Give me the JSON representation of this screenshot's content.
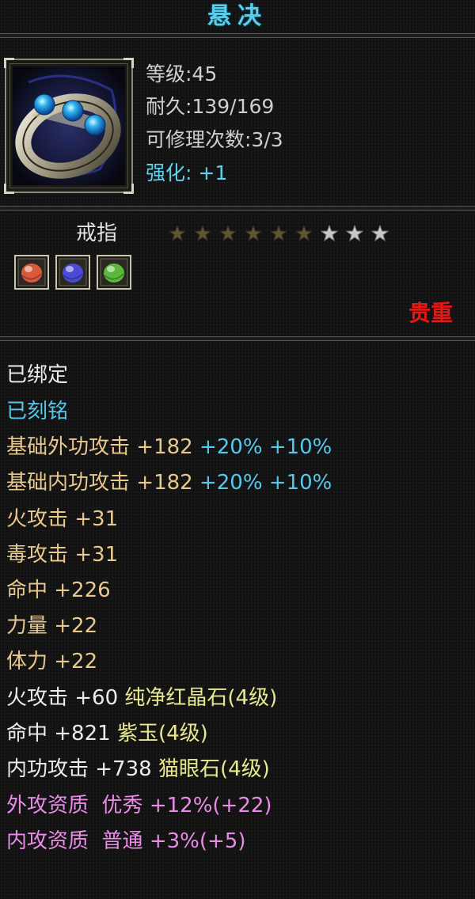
{
  "title": "悬决",
  "item": {
    "level_line": "等级:45",
    "durability_line": "耐久:139/169",
    "repair_line": "可修理次数:3/3",
    "strengthen_line": "强化: +1"
  },
  "item_type": "戒指",
  "stars": {
    "total": 9,
    "lit": 6
  },
  "gem_slots": [
    {
      "icon": "red-gem-icon",
      "color": "#d85a3a"
    },
    {
      "icon": "purple-gem-icon",
      "color": "#4a4ad8"
    },
    {
      "icon": "green-gem-icon",
      "color": "#5ab83a"
    }
  ],
  "rarity": "贵重",
  "status": {
    "bound": "已绑定",
    "engraved": "已刻铭"
  },
  "stats": [
    {
      "label": "基础外功攻击",
      "value": "+182",
      "bonus1": "+20%",
      "bonus2": "+10%"
    },
    {
      "label": "基础内功攻击",
      "value": "+182",
      "bonus1": "+20%",
      "bonus2": "+10%"
    }
  ],
  "attrs": [
    "火攻击 +31",
    "毒攻击 +31",
    "命中 +226",
    "力量 +22",
    "体力 +22"
  ],
  "gem_stats": [
    {
      "stat": "火攻击 +60",
      "gem": "纯净红晶石(4级)"
    },
    {
      "stat": "命中 +821",
      "gem": "紫玉(4级)"
    },
    {
      "stat": "内功攻击 +738",
      "gem": "猫眼石(4级)"
    }
  ],
  "aptitudes": [
    {
      "label": "外攻资质",
      "grade": "优秀",
      "value": "+12%(+22)"
    },
    {
      "label": "内攻资质",
      "grade": "普通",
      "value": "+3%(+5)"
    }
  ],
  "colors": {
    "title": "#5bcde8",
    "cyan": "#56c8ec",
    "attr_tan": "#e8c88c",
    "gem_gold": "#e8e890",
    "aptitude_pink": "#e88ce8",
    "rarity_red": "#e51818",
    "star_lit": "#5a5636",
    "star_unlit": "#c8c8c8"
  }
}
